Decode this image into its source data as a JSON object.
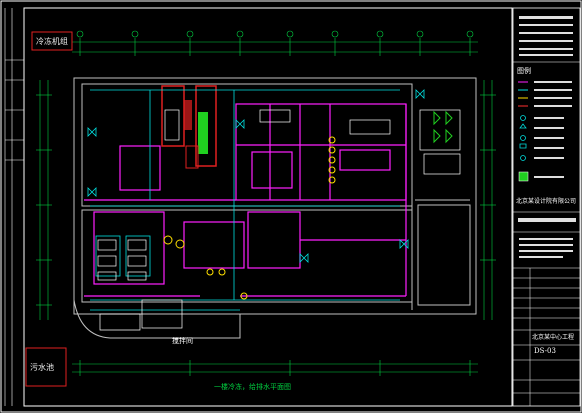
{
  "drawing": {
    "top_left_label": "冷冻机组",
    "bottom_left_label": "污水池",
    "floor_label": "搅拌间",
    "bottom_caption": "一楼冷冻，给排水平面图",
    "stamp_text": "冷冻机组"
  },
  "title_block": {
    "legend_heading": "图例",
    "project_name": "北京某中心工程",
    "drawing_no": "DS-03",
    "company_line": "北京某设计院有限公司"
  },
  "colors": {
    "background": "#000000",
    "frame": "#ffffff",
    "dim": "#00d040",
    "pipe_magenta": "#ff20ff",
    "pipe_cyan": "#00e0e0",
    "wall": "#c0c0c0",
    "accent_red": "#e02020",
    "accent_yellow": "#ffe000",
    "accent_green": "#20d020"
  }
}
